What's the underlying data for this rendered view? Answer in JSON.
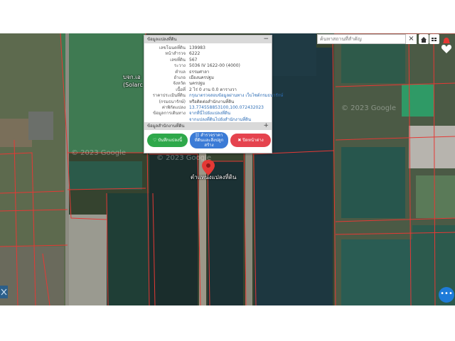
{
  "map": {
    "search_placeholder": "ค้นหาสถานที่สำคัญ",
    "search_clear": "×",
    "place_label_line1": "บจก.เอ",
    "place_label_line2": "(Solarc",
    "watermarks": [
      "© 2023 Google",
      "© 2023 Google",
      "© 2023 Google"
    ],
    "pin_label": "ตำแหน่งแปลงที่ดิน",
    "accent_color": "#e5434e",
    "boundary_color": "#e53935"
  },
  "panel": {
    "header": "ข้อมูลแปลงที่ดิน",
    "header_control": "−",
    "rows": [
      {
        "label": "เลขโฉนดที่ดิน",
        "value": "139983"
      },
      {
        "label": "หน้าสำรวจ",
        "value": "6222"
      },
      {
        "label": "เลขที่ดิน",
        "value": "567"
      },
      {
        "label": "ระวาง",
        "value": "5036 IV 1622-00 (4000)"
      },
      {
        "label": "ตำบล",
        "value": "ธรรมศาลา"
      },
      {
        "label": "อำเภอ",
        "value": "เมืองนครปฐม"
      },
      {
        "label": "จังหวัด",
        "value": "นครปฐม"
      },
      {
        "label": "เนื้อที่",
        "value": "2 ไร่ 0 งาน 0.0 ตารางวา"
      },
      {
        "label": "ราคาประเมินที่ดิน",
        "value": "กรุณาตรวจสอบข้อมูลผ่านทาง เว็บไซต์กรมธนารักษ์"
      },
      {
        "label": "(กรมธนารักษ์)",
        "value": "หรือติดต่อสำนักงานที่ดิน"
      },
      {
        "label": "ค่าพิกัดแปลง",
        "value": "13.774558853100,100.072432023"
      },
      {
        "label": "ข้อมูลการเดินทาง",
        "value": "จากที่นี่ไปยังแปลงที่ดิน"
      },
      {
        "label": "",
        "value": "จากแปลงที่ดินไปยังสำนักงานที่ดิน"
      }
    ],
    "subheader": "ข้อมูลสำนักงานที่ดิน",
    "subheader_control": "+",
    "buttons": {
      "save": "♡ บันทึกแปลงนี้",
      "report": "☷ สำรวจราคาที่ดินและสิ่งปลูกสร้าง",
      "close": "✖ ปิดหน้าต่าง"
    }
  },
  "fab_label": "•••"
}
